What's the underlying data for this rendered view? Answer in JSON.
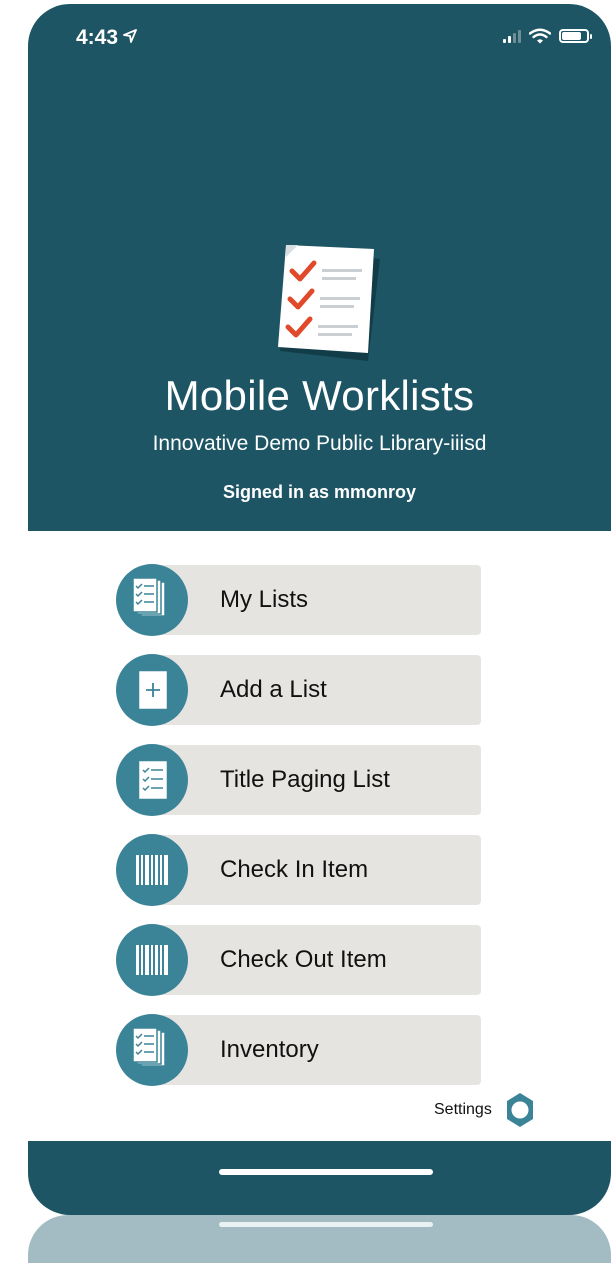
{
  "status_bar": {
    "time": "4:43"
  },
  "header": {
    "app_title": "Mobile Worklists",
    "org_name": "Innovative Demo Public Library-iiisd",
    "signed_in": "Signed in as mmonroy"
  },
  "menu": {
    "items": [
      {
        "label": "My Lists",
        "icon": "list-stack-icon"
      },
      {
        "label": "Add a List",
        "icon": "add-list-icon"
      },
      {
        "label": "Title Paging List",
        "icon": "checklist-icon"
      },
      {
        "label": "Check In Item",
        "icon": "barcode-icon"
      },
      {
        "label": "Check Out Item",
        "icon": "barcode-icon"
      },
      {
        "label": "Inventory",
        "icon": "list-stack-icon"
      }
    ]
  },
  "settings": {
    "label": "Settings",
    "icon": "gear-icon"
  },
  "colors": {
    "header": "#1d5564",
    "accent": "#3b8497",
    "button_bg": "#e6e4e1",
    "check": "#e04a2a"
  }
}
